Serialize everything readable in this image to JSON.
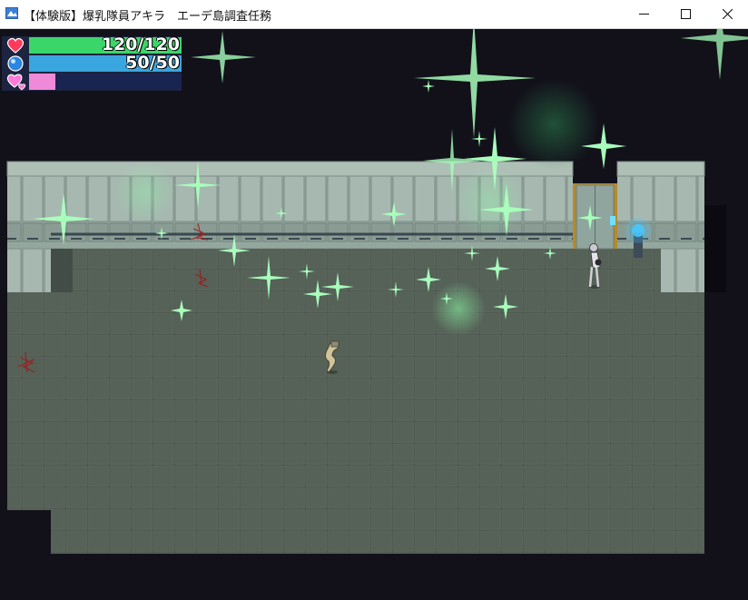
{
  "window": {
    "title": "【体験版】爆乳隊員アキラ　エーデ島調査任務",
    "minimize_icon": "minimize-icon",
    "maximize_icon": "maximize-icon",
    "close_icon": "close-icon"
  },
  "hud": {
    "hp": {
      "text": "120/120",
      "current": 120,
      "max": 120,
      "color": "#3bd66a",
      "icon": "heart-icon"
    },
    "mp": {
      "text": "50/50",
      "current": 50,
      "max": 50,
      "color": "#3aa6e0",
      "icon": "blue-orb-icon"
    },
    "lust": {
      "fraction": 0.17,
      "color": "#f08ad8",
      "icon": "pink-heart-icon"
    }
  },
  "colors": {
    "floor": "#566158",
    "floor_grid": "#47514a",
    "wall": "#8fa39a",
    "sparkle": "#7dff9c"
  }
}
